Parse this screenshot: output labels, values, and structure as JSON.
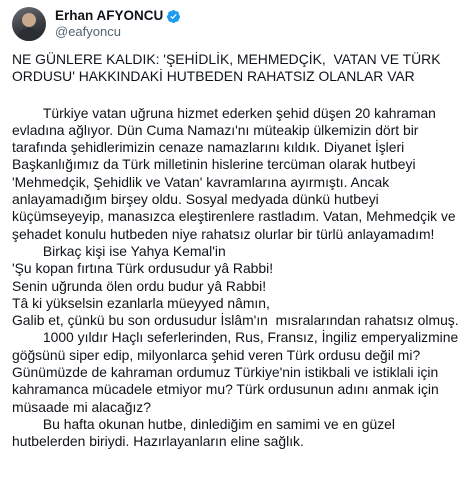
{
  "author": {
    "display_name": "Erhan AFYONCU",
    "handle": "@eafyoncu",
    "verified_color": "#1d9bf0"
  },
  "post": {
    "headline": "NE GÜNLERE KALDIK: 'ŞEHİDLİK, MEHMEDÇİK,  VATAN VE TÜRK ORDUSU' HAKKINDAKİ HUTBEDEN RAHATSIZ OLANLAR VAR",
    "paragraph_1": "        Türkiye vatan uğruna hizmet ederken şehid düşen 20 kahraman evladına ağlıyor. Dün Cuma Namazı'nı müteakip ülkemizin dört bir tarafında şehidlerimizin cenaze namazlarını kıldık. Diyanet İşleri Başkanlığımız da Türk milletinin hislerine tercüman olarak hutbeyi 'Mehmedçik, Şehidlik ve Vatan' kavramlarına ayırmıştı. Ancak anlayamadığım birşey oldu. Sosyal medyada dünkü hutbeyi küçümseyeyip, manasızca eleştirenlere rastladım. Vatan, Mehmedçik ve şehadet konulu hutbeden niye rahatsız olurlar bir türlü anlayamadım!",
    "paragraph_2": "        Birkaç kişi ise Yahya Kemal'in",
    "poem_1": "'Şu kopan fırtına Türk ordusudur yâ Rabbi!",
    "poem_2": "Senin uğrunda ölen ordu budur yâ Rabbi!",
    "poem_3": "Tâ ki yükselsin ezanlarla müeyyed nâmın,",
    "poem_4": "Galib et, çünkü bu son ordusudur İslâm'ın  mısralarından rahatsız olmuş.",
    "paragraph_3": "        1000 yıldır Haçlı seferlerinden, Rus, Fransız, İngiliz emperyalizmine göğsünü siper edip, milyonlarca şehid veren Türk ordusu değil mi? Günümüzde de kahraman ordumuz Türkiye'nin istikbali ve istiklali için kahramanca mücadele etmiyor mu? Türk ordusunun adını anmak için müsaade mi alacağız?",
    "paragraph_4": "        Bu hafta okunan hutbe, dinlediğim en samimi ve en güzel hutbelerden biriydi. Hazırlayanların eline sağlık."
  }
}
